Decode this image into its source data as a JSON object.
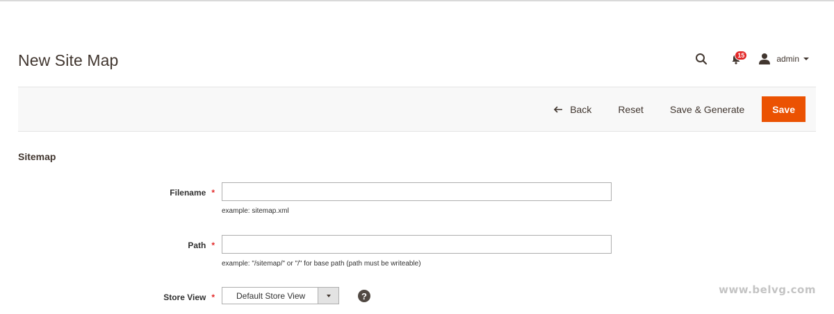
{
  "page": {
    "title": "New Site Map"
  },
  "header": {
    "search_icon": "search-icon",
    "notifications": {
      "icon": "bell-icon",
      "count": "15"
    },
    "user": {
      "icon": "user-icon",
      "name": "admin"
    }
  },
  "action_bar": {
    "back_label": "Back",
    "reset_label": "Reset",
    "save_generate_label": "Save & Generate",
    "save_label": "Save"
  },
  "form": {
    "section_title": "Sitemap",
    "filename": {
      "label": "Filename",
      "required": "*",
      "value": "",
      "note": "example: sitemap.xml"
    },
    "path": {
      "label": "Path",
      "required": "*",
      "value": "",
      "note": "example: \"/sitemap/\" or \"/\" for base path (path must be writeable)"
    },
    "store_view": {
      "label": "Store View",
      "required": "*",
      "selected": "Default Store View",
      "help": "?"
    }
  },
  "watermark": "www.belvg.com",
  "colors": {
    "accent": "#eb5202",
    "badge": "#e22626",
    "text": "#41362f",
    "bar_bg": "#f8f8f8"
  }
}
